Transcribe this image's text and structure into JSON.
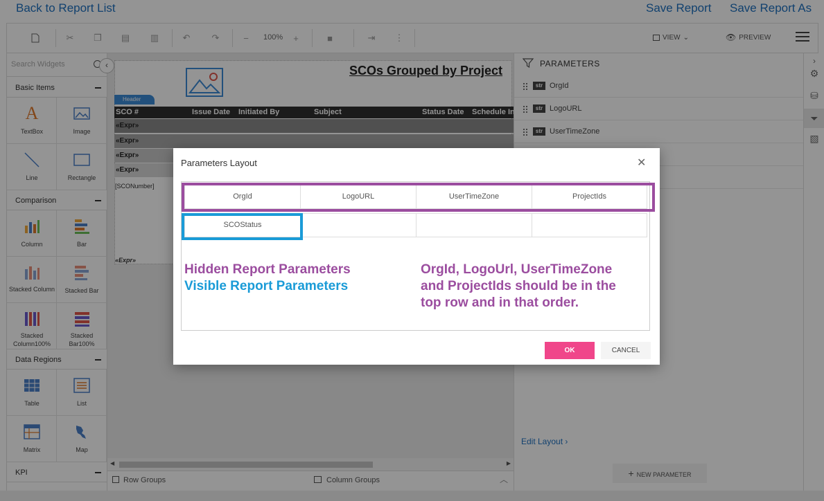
{
  "topbar": {
    "back_label": "Back to Report List",
    "save_label": "Save Report",
    "save_as_label": "Save Report As"
  },
  "toolbar": {
    "zoom": "100%",
    "view_label": "VIEW",
    "preview_label": "PREVIEW"
  },
  "left_panel": {
    "search_placeholder": "Search Widgets",
    "sections": {
      "basic": "Basic Items",
      "comparison": "Comparison",
      "data_regions": "Data Regions",
      "kpi": "KPI"
    },
    "widgets": {
      "textbox": "TextBox",
      "image": "Image",
      "line": "Line",
      "rectangle": "Rectangle",
      "column": "Column",
      "bar": "Bar",
      "stacked_column": "Stacked Column",
      "stacked_bar": "Stacked Bar",
      "stacked_column100": "Stacked Column100%",
      "stacked_bar100": "Stacked Bar100%",
      "table": "Table",
      "list": "List",
      "matrix": "Matrix",
      "map": "Map"
    }
  },
  "canvas": {
    "report_title": "SCOs Grouped by Project",
    "header_tag": "Header",
    "columns": [
      "SCO #",
      "Issue Date",
      "Initiated By",
      "Subject",
      "Status Date",
      "Schedule In"
    ],
    "expr": "«Expr»",
    "field": "[SCONumber]"
  },
  "bottom_bar": {
    "row_groups": "Row Groups",
    "column_groups": "Column Groups"
  },
  "right_panel": {
    "title": "PARAMETERS",
    "str_badge": "str",
    "params": [
      "OrgId",
      "LogoURL",
      "UserTimeZone"
    ],
    "edit_layout": "Edit Layout",
    "new_parameter": "NEW PARAMETER"
  },
  "modal": {
    "title": "Parameters Layout",
    "row1": [
      "OrgId",
      "LogoURL",
      "UserTimeZone",
      "ProjectIds"
    ],
    "row2": [
      "SCOStatus",
      "",
      "",
      ""
    ],
    "ann_hidden": "Hidden Report Parameters",
    "ann_visible": "Visible Report Parameters",
    "ann_note_1": "OrgId, LogoUrl, UserTimeZone",
    "ann_note_2": "and ProjectIds should be in the",
    "ann_note_3": "top row and in that order.",
    "ok_label": "OK",
    "cancel_label": "CANCEL"
  },
  "colors": {
    "link_blue": "#1e70bf",
    "annotation_purple": "#9b4d9f",
    "annotation_blue": "#1a9bd7",
    "ok_pink": "#f0468a"
  }
}
